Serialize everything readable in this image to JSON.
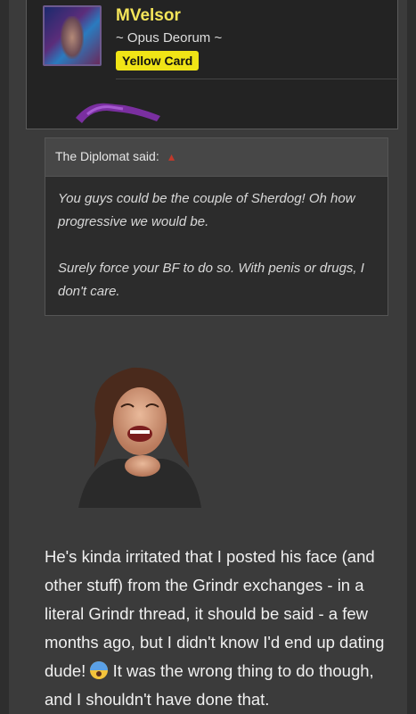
{
  "user": {
    "name": "MVelsor",
    "title": "~ Opus Deorum ~",
    "badge": "Yellow Card"
  },
  "quote": {
    "author": "The Diplomat said:",
    "arrow_icon": "up-arrow-icon",
    "lines": [
      "You guys could be the couple of Sherdog! Oh how progressive we would be.",
      "Surely force your BF to do so. With penis or drugs, I don't care."
    ]
  },
  "post": {
    "text_before_emoji": "He's kinda irritated that I posted his face (and other stuff) from the Grindr exchanges - in a literal Grindr thread, it should be said - a few months ago, but I didn't know I'd end up dating dude!",
    "emoji": "shocked-face-icon",
    "text_after_emoji": " It was the wrong thing to do though, and I shouldn't have done that."
  },
  "colors": {
    "username": "#f4e55a",
    "badge_bg": "#f0e416",
    "background": "#3a3a3a",
    "quote_bg": "#2c2c2c",
    "quote_header_bg": "#474747",
    "arrow": "#c0392b"
  }
}
